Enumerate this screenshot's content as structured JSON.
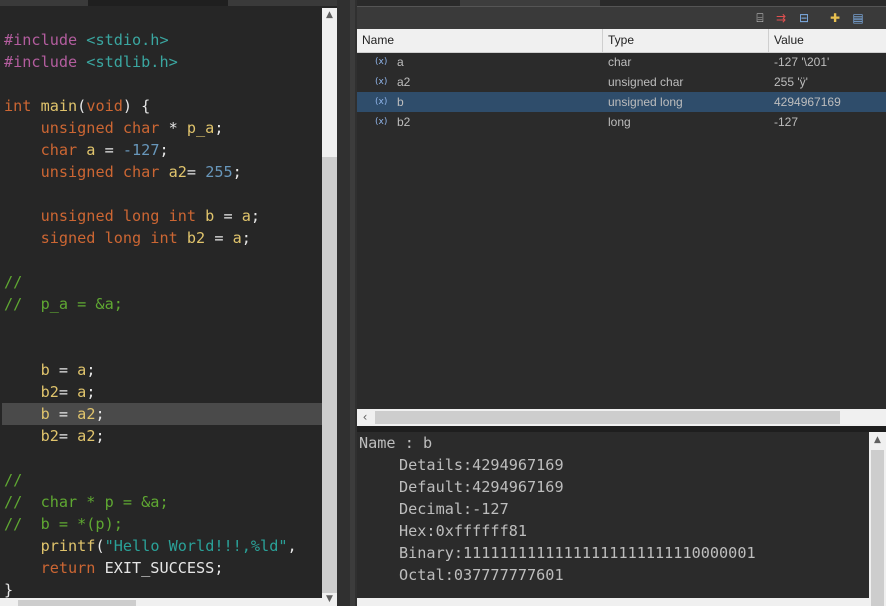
{
  "editor": {
    "lines": [
      {
        "y": 0,
        "segments": [
          [
            "pp",
            "#include "
          ],
          [
            "inc",
            "<stdio.h>"
          ]
        ]
      },
      {
        "y": 1,
        "segments": [
          [
            "pp",
            "#include "
          ],
          [
            "inc",
            "<stdlib.h>"
          ]
        ]
      },
      {
        "y": 3,
        "segments": [
          [
            "kw",
            "int "
          ],
          [
            "fn",
            "main"
          ],
          [
            "op",
            "("
          ],
          [
            "kw",
            "void"
          ],
          [
            "op",
            ") {"
          ]
        ]
      },
      {
        "y": 4,
        "segments": [
          [
            "op",
            "    "
          ],
          [
            "kw",
            "unsigned char"
          ],
          [
            "op",
            " * "
          ],
          [
            "var",
            "p_a"
          ],
          [
            "op",
            ";"
          ]
        ]
      },
      {
        "y": 5,
        "segments": [
          [
            "op",
            "    "
          ],
          [
            "kw",
            "char "
          ],
          [
            "var",
            "a"
          ],
          [
            "op",
            " = "
          ],
          [
            "num",
            "-127"
          ],
          [
            "op",
            ";"
          ]
        ]
      },
      {
        "y": 6,
        "segments": [
          [
            "op",
            "    "
          ],
          [
            "kw",
            "unsigned char "
          ],
          [
            "var",
            "a2"
          ],
          [
            "op",
            "= "
          ],
          [
            "num",
            "255"
          ],
          [
            "op",
            ";"
          ]
        ]
      },
      {
        "y": 8,
        "segments": [
          [
            "op",
            "    "
          ],
          [
            "kw",
            "unsigned long int "
          ],
          [
            "var",
            "b"
          ],
          [
            "op",
            " = "
          ],
          [
            "var",
            "a"
          ],
          [
            "op",
            ";"
          ]
        ]
      },
      {
        "y": 9,
        "segments": [
          [
            "op",
            "    "
          ],
          [
            "kw",
            "signed long int "
          ],
          [
            "var",
            "b2"
          ],
          [
            "op",
            " = "
          ],
          [
            "var",
            "a"
          ],
          [
            "op",
            ";"
          ]
        ]
      },
      {
        "y": 11,
        "segments": [
          [
            "cm",
            "//"
          ]
        ]
      },
      {
        "y": 12,
        "segments": [
          [
            "cm",
            "//  p_a = &a;"
          ]
        ]
      },
      {
        "y": 15,
        "segments": [
          [
            "op",
            "    "
          ],
          [
            "var",
            "b"
          ],
          [
            "op",
            " = "
          ],
          [
            "var",
            "a"
          ],
          [
            "op",
            ";"
          ]
        ]
      },
      {
        "y": 16,
        "segments": [
          [
            "op",
            "    "
          ],
          [
            "var",
            "b2"
          ],
          [
            "op",
            "= "
          ],
          [
            "var",
            "a"
          ],
          [
            "op",
            ";"
          ]
        ]
      },
      {
        "y": 17,
        "highlight": true,
        "segments": [
          [
            "op",
            "    "
          ],
          [
            "var",
            "b"
          ],
          [
            "op",
            " = "
          ],
          [
            "var",
            "a2"
          ],
          [
            "op",
            ";"
          ]
        ]
      },
      {
        "y": 18,
        "segments": [
          [
            "op",
            "    "
          ],
          [
            "var",
            "b2"
          ],
          [
            "op",
            "= "
          ],
          [
            "var",
            "a2"
          ],
          [
            "op",
            ";"
          ]
        ]
      },
      {
        "y": 20,
        "segments": [
          [
            "cm",
            "//"
          ]
        ]
      },
      {
        "y": 21,
        "segments": [
          [
            "cm",
            "//  char * p = &a;"
          ]
        ]
      },
      {
        "y": 22,
        "segments": [
          [
            "cm",
            "//  b = *(p);"
          ]
        ]
      },
      {
        "y": 23,
        "segments": [
          [
            "op",
            "    "
          ],
          [
            "fn",
            "printf"
          ],
          [
            "op",
            "("
          ],
          [
            "str",
            "\"Hello World!!!,%ld\""
          ],
          [
            "op",
            ","
          ]
        ]
      },
      {
        "y": 24,
        "segments": [
          [
            "op",
            "    "
          ],
          [
            "kw",
            "return "
          ],
          [
            "op",
            "EXIT_SUCCESS;"
          ]
        ]
      },
      {
        "y": 25,
        "segments": [
          [
            "op",
            "}"
          ]
        ]
      }
    ]
  },
  "variables": {
    "columns": [
      "Name",
      "Type",
      "Value"
    ],
    "rows": [
      {
        "name": "a",
        "type": "char",
        "value": "-127 '\\201'",
        "selected": false
      },
      {
        "name": "a2",
        "type": "unsigned char",
        "value": "255 'ÿ'",
        "selected": false
      },
      {
        "name": "b",
        "type": "unsigned long",
        "value": "4294967169",
        "selected": true
      },
      {
        "name": "b2",
        "type": "long",
        "value": "-127",
        "selected": false
      }
    ]
  },
  "details": {
    "title": "Name : b",
    "items": [
      "Details:4294967169",
      "Default:4294967169",
      "Decimal:-127",
      "Hex:0xffffff81",
      "Binary:11111111111111111111111110000001",
      "Octal:037777777601"
    ]
  },
  "icons": {
    "variable": "variable-icon",
    "toolbar": [
      "show-type-names-icon",
      "show-logical-structure-icon",
      "collapse-all-icon",
      "add-watch-icon",
      "open-view-menu-icon"
    ]
  }
}
